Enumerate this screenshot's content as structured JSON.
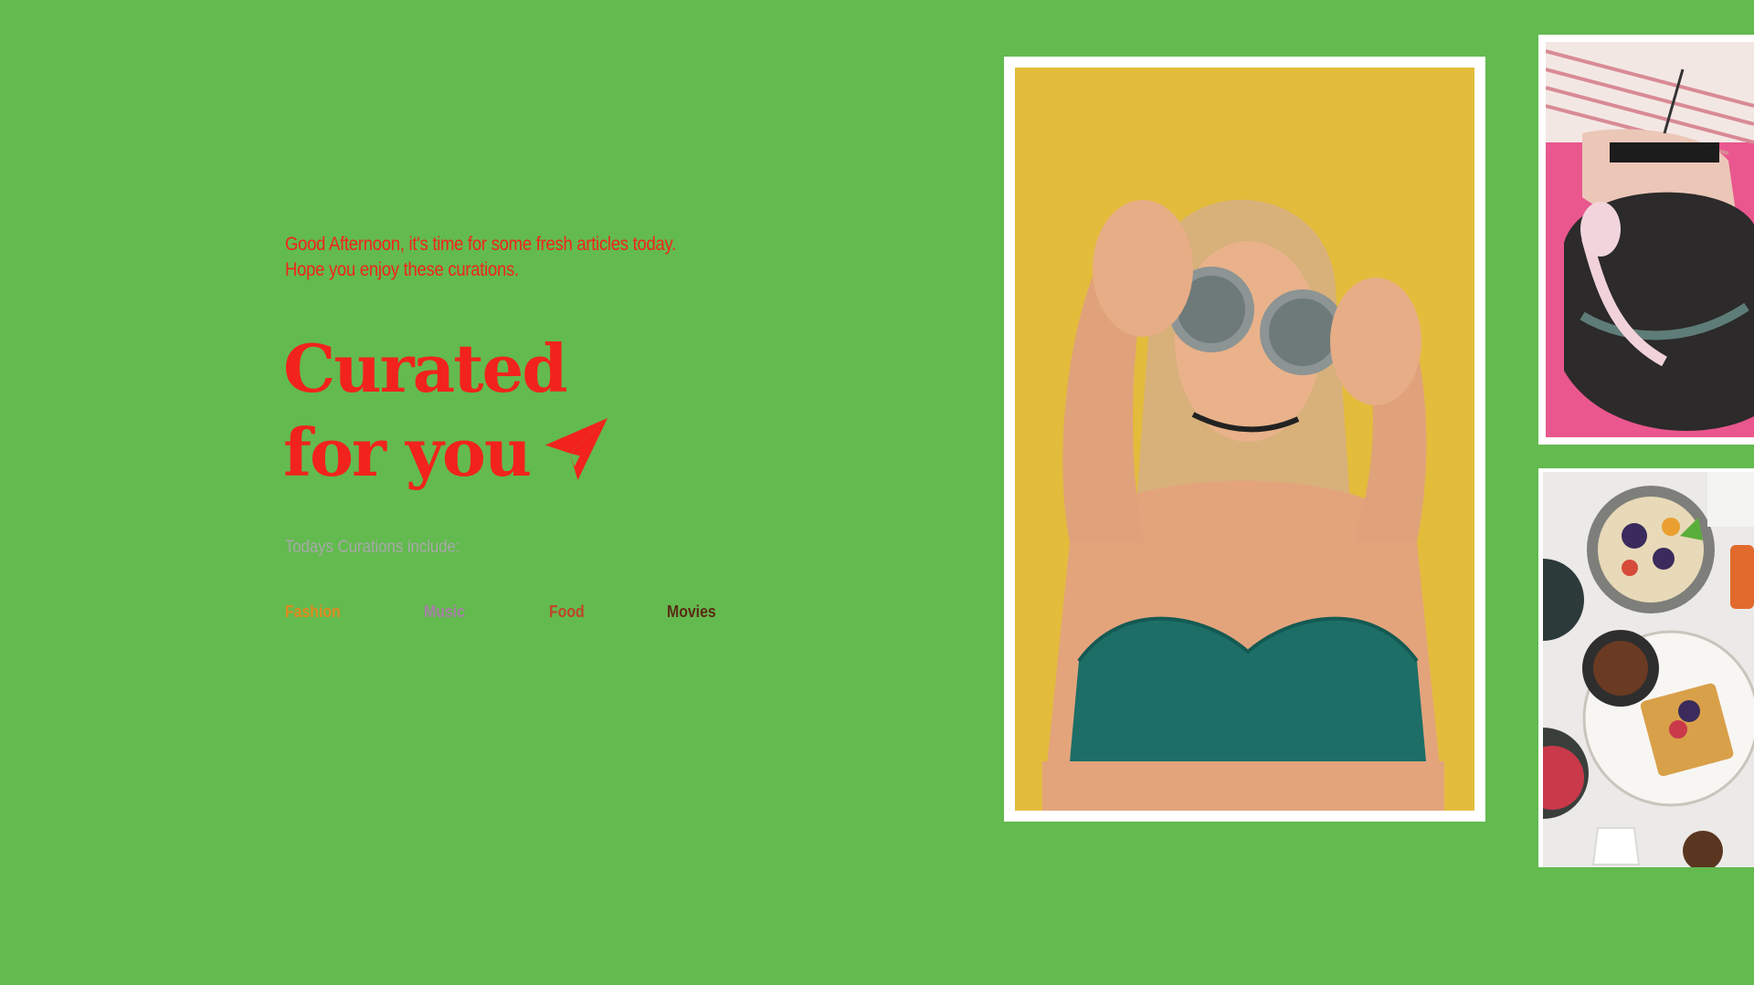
{
  "greeting": {
    "line1": "Good Afternoon, it's time for some fresh articles today.",
    "line2": "Hope you enjoy these curations."
  },
  "headline": {
    "line1": "Curated",
    "line2": "for you",
    "icon": "paper-plane-icon"
  },
  "curations": {
    "label": "Todays Curations include:",
    "categories": [
      {
        "label": "Fashion",
        "color": "#E08A21"
      },
      {
        "label": "Music",
        "color": "#A77DA6"
      },
      {
        "label": "Food",
        "color": "#C0442A"
      },
      {
        "label": "Movies",
        "color": "#5A2A14"
      }
    ]
  },
  "colors": {
    "background": "#63BA4F",
    "accent": "#F2231D",
    "muted": "#A8A8A8",
    "card": "#FFFFFF"
  }
}
